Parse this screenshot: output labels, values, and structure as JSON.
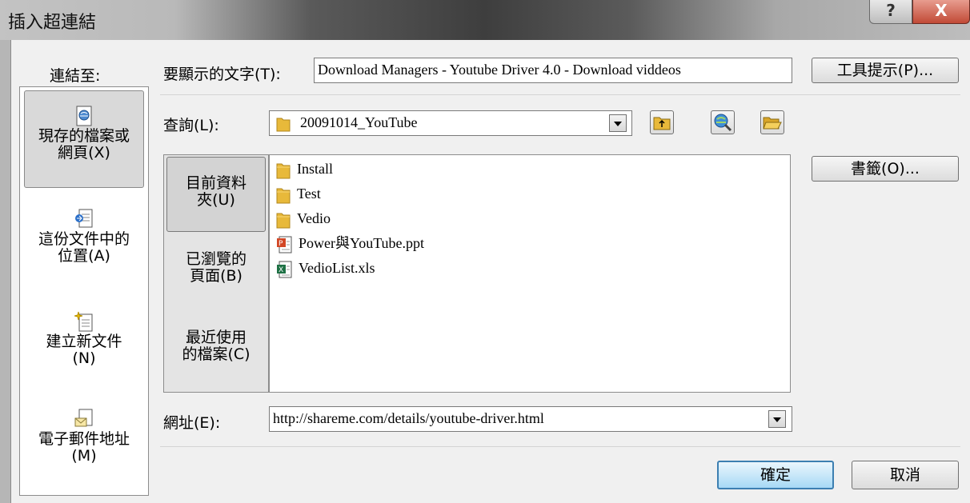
{
  "window": {
    "title": "插入超連結",
    "help_label": "?",
    "close_label": "X"
  },
  "link_to": {
    "label": "連結至:",
    "items": [
      {
        "line1": "現存的檔案或",
        "line2": "網頁(X)",
        "icon": "web-page-icon",
        "selected": true
      },
      {
        "line1": "這份文件中的",
        "line2": "位置(A)",
        "icon": "document-place-icon",
        "selected": false
      },
      {
        "line1": "建立新文件",
        "line2": "(N)",
        "icon": "new-document-icon",
        "selected": false
      },
      {
        "line1": "電子郵件地址",
        "line2": "(M)",
        "icon": "email-icon",
        "selected": false
      }
    ]
  },
  "display_text": {
    "label": "要顯示的文字(T):",
    "value": "Download Managers - Youtube Driver 4.0 - Download viddeos"
  },
  "screentip_button": "工具提示(P)...",
  "look_in": {
    "label": "查詢(L):",
    "value": "20091014_YouTube"
  },
  "folder_tabs": [
    {
      "line1": "目前資料",
      "line2": "夾(U)",
      "selected": true
    },
    {
      "line1": "已瀏覽的",
      "line2": "頁面(B)",
      "selected": false
    },
    {
      "line1": "最近使用",
      "line2": "的檔案(C)",
      "selected": false
    }
  ],
  "files": [
    {
      "name": "Install",
      "icon": "folder-icon"
    },
    {
      "name": "Test",
      "icon": "folder-icon"
    },
    {
      "name": "Vedio",
      "icon": "folder-icon"
    },
    {
      "name": "Power與YouTube.ppt",
      "icon": "powerpoint-file-icon"
    },
    {
      "name": "VedioList.xls",
      "icon": "excel-file-icon"
    }
  ],
  "bookmark_button": "書籤(O)...",
  "address": {
    "label": "網址(E):",
    "value": "http://shareme.com/details/youtube-driver.html"
  },
  "ok_button": "確定",
  "cancel_button": "取消",
  "colors": {
    "selected_bg": "#d9d9d9",
    "default_button_border": "#3c7fb1",
    "close_button": "#c14a36"
  }
}
